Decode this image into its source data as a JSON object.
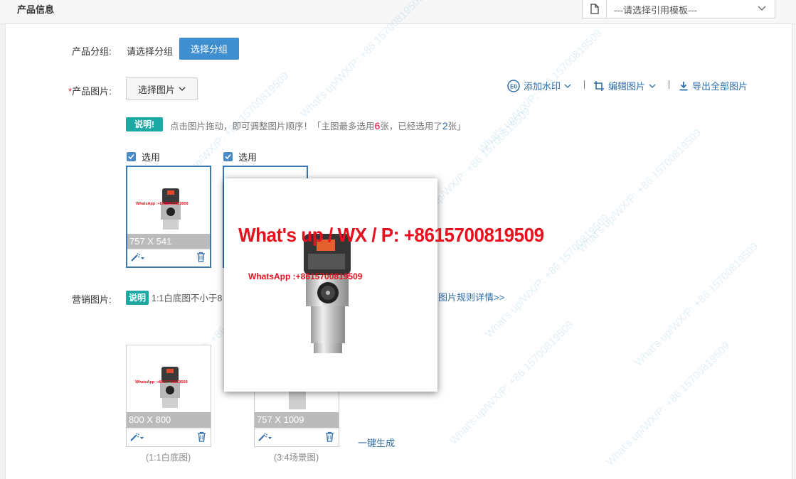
{
  "header": {
    "title": "产品信息",
    "template_select": "---请选择引用模板---"
  },
  "group": {
    "label": "产品分组:",
    "placeholder": "请选择分组",
    "button": "选择分组"
  },
  "product_images": {
    "required_mark": "*",
    "label": "产品图片:",
    "select_button": "选择图片",
    "tools": {
      "watermark": "添加水印",
      "edit": "编辑图片",
      "export": "导出全部图片"
    },
    "note_badge": "说明!",
    "note_prefix": "点击图片拖动，即可调整图片顺序！「主图最多选用",
    "note_max": "6",
    "note_mid": "张，已经选用了",
    "note_used": "2",
    "note_suffix": "张」",
    "items": [
      {
        "check_label": "选用",
        "dims": "757 X 541"
      },
      {
        "check_label": "选用",
        "dims": ""
      }
    ]
  },
  "marketing_images": {
    "label": "营销图片:",
    "note_badge": "说明",
    "note_text": "1:1白底图不小于8",
    "rules_link": "图片规则详情>>",
    "items": [
      {
        "dims": "800 X 800",
        "caption": "(1:1白底图)"
      },
      {
        "dims": "757 X 1009",
        "caption": "(3:4场景图)"
      }
    ],
    "generate_link": "一键生成"
  },
  "preview": {
    "overlay_text": "What's up / WX / P: +8615700819509",
    "whatsapp_text": "WhatsApp :+8615700819509",
    "thumb_whatsapp": "WhatsApp :+8615700819509"
  },
  "watermark_text": "What's up/WX/P: +86 15700819509",
  "colors": {
    "primary": "#3e8ed0",
    "badge": "#1ca9a4",
    "link": "#2f6ea8",
    "red": "#e8101c"
  }
}
